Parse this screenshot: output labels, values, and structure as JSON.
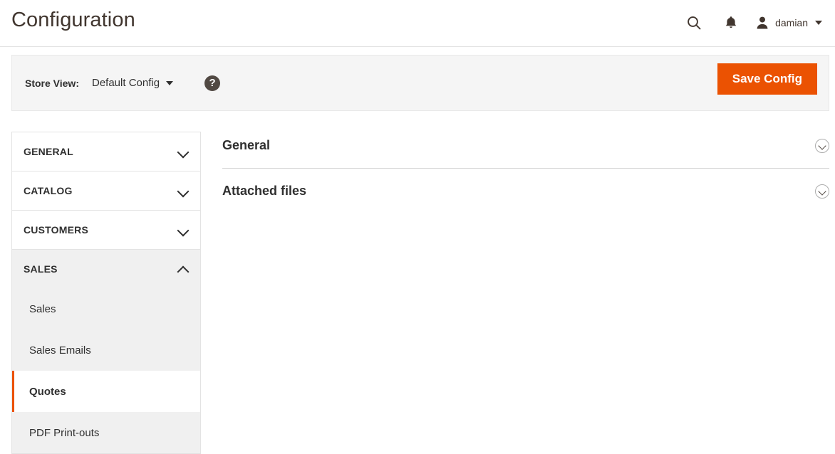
{
  "header": {
    "title": "Configuration",
    "search_icon": "search-icon",
    "notifications_icon": "bell-icon",
    "avatar_icon": "user-avatar-icon",
    "user_name": "damian",
    "caret_icon": "caret-down-icon"
  },
  "storeview": {
    "label": "Store View:",
    "selected": "Default Config",
    "caret_icon": "caret-down-icon",
    "help_icon": "question-mark-icon",
    "help_glyph": "?",
    "save_label": "Save Config"
  },
  "sidebar": {
    "sections": [
      {
        "label": "GENERAL",
        "expanded": false,
        "chevron": "chevron-down-icon",
        "items": []
      },
      {
        "label": "CATALOG",
        "expanded": false,
        "chevron": "chevron-down-icon",
        "items": []
      },
      {
        "label": "CUSTOMERS",
        "expanded": false,
        "chevron": "chevron-down-icon",
        "items": []
      },
      {
        "label": "SALES",
        "expanded": true,
        "chevron": "chevron-up-icon",
        "items": [
          {
            "label": "Sales",
            "active": false
          },
          {
            "label": "Sales Emails",
            "active": false
          },
          {
            "label": "Quotes",
            "active": true
          },
          {
            "label": "PDF Print-outs",
            "active": false
          }
        ]
      }
    ]
  },
  "main": {
    "fieldsets": [
      {
        "title": "General",
        "toggle_icon": "circle-chevron-down-icon",
        "expanded": false
      },
      {
        "title": "Attached files",
        "toggle_icon": "circle-chevron-down-icon",
        "expanded": false
      }
    ]
  },
  "colors": {
    "accent_orange": "#eb5202",
    "header_text": "#41362f",
    "body_text": "#303030",
    "panel_gray": "#f5f5f5",
    "nav_active_gray": "#f0f0f0",
    "help_circle": "#514943"
  }
}
